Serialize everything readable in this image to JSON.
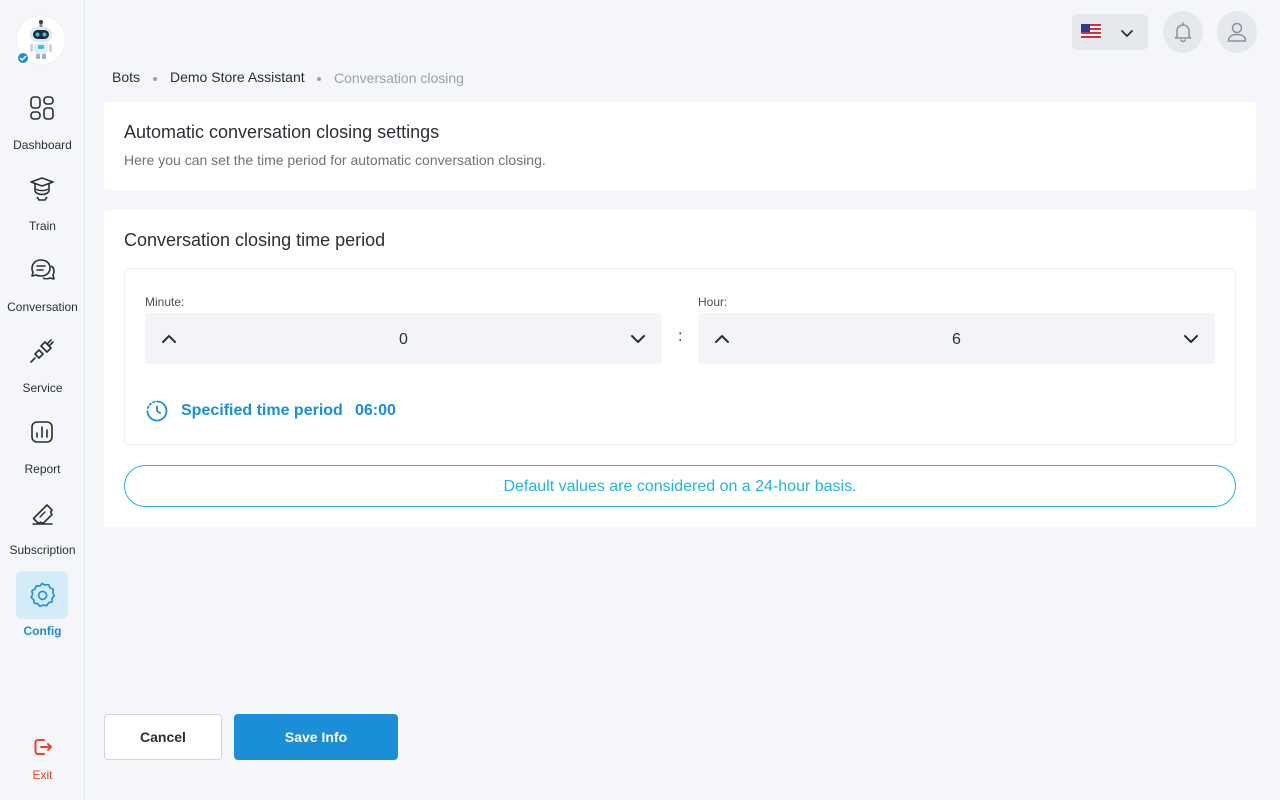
{
  "sidebar": {
    "items": [
      {
        "label": "Dashboard",
        "icon": "dashboard-icon"
      },
      {
        "label": "Train",
        "icon": "graduation-cap-icon"
      },
      {
        "label": "Conversation",
        "icon": "chat-icon"
      },
      {
        "label": "Service",
        "icon": "plug-icon"
      },
      {
        "label": "Report",
        "icon": "chart-icon"
      },
      {
        "label": "Subscription",
        "icon": "ticket-icon"
      },
      {
        "label": "Config",
        "icon": "gear-icon",
        "active": true
      }
    ],
    "exit_label": "Exit"
  },
  "breadcrumb": [
    "Bots",
    "Demo Store Assistant",
    "Conversation closing"
  ],
  "settings_card": {
    "title": "Automatic conversation closing settings",
    "subtitle": "Here you can set the time period for automatic conversation closing."
  },
  "period_card": {
    "title": "Conversation closing time period",
    "minute_label": "Minute:",
    "minute_value": "0",
    "hour_label": "Hour:",
    "hour_value": "6",
    "separator": ":",
    "specified_label": "Specified time period",
    "specified_value": "06:00",
    "note": "Default values are considered on a 24-hour basis."
  },
  "footer": {
    "cancel_label": "Cancel",
    "save_label": "Save Info"
  },
  "colors": {
    "accent": "#1a8fd8",
    "note": "#1fb8d6",
    "exit": "#e9442e",
    "active_bg": "#d4ebf8"
  }
}
